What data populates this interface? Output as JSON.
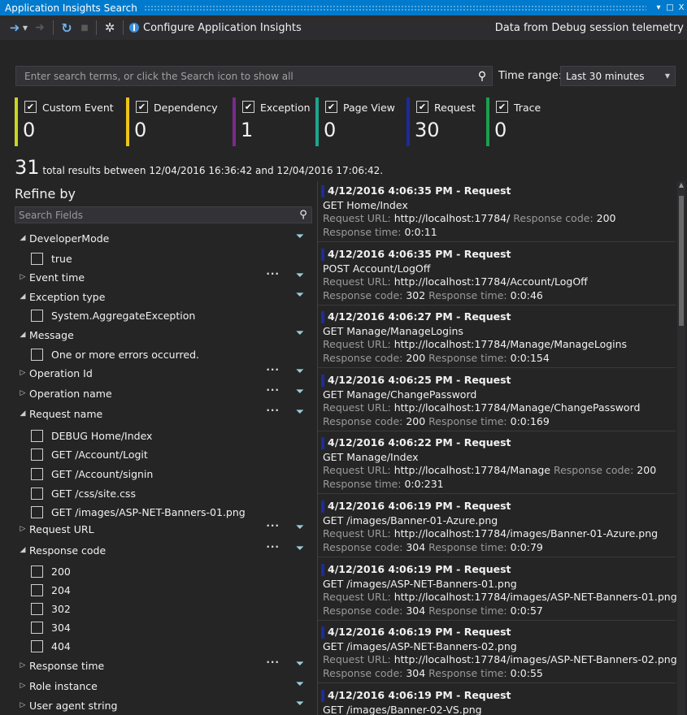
{
  "window": {
    "title": "Application Insights Search",
    "dropdown_glyph": "▾",
    "maximize_glyph": "□",
    "close_glyph": "X"
  },
  "toolbar": {
    "configure_label": "Configure Application Insights",
    "data_source": "Data from Debug session telemetry"
  },
  "search": {
    "placeholder": "Enter search terms, or click the Search icon to show all",
    "time_range_label": "Time range:",
    "time_range_value": "Last 30 minutes"
  },
  "filters": [
    {
      "label": "Custom Event",
      "count": "0",
      "color": "#c9d61d"
    },
    {
      "label": "Dependency",
      "count": "0",
      "color": "#ecc31a"
    },
    {
      "label": "Exception",
      "count": "1",
      "color": "#7b2a8c"
    },
    {
      "label": "Page View",
      "count": "0",
      "color": "#1ca68e"
    },
    {
      "label": "Request",
      "count": "30",
      "color": "#1c2b9c"
    },
    {
      "label": "Trace",
      "count": "0",
      "color": "#1aa14a"
    }
  ],
  "summary": {
    "total": "31",
    "text": "total results between 12/04/2016 16:36:42 and 12/04/2016 17:06:42."
  },
  "refine": {
    "title": "Refine by",
    "search_placeholder": "Search Fields",
    "rows": [
      {
        "label": "DeveloperMode",
        "expanded": true,
        "more": false
      },
      {
        "value": "true"
      },
      {
        "label": "Event time",
        "expanded": false,
        "more": true
      },
      {
        "label": "Exception type",
        "expanded": true,
        "more": false
      },
      {
        "value": "System.AggregateException"
      },
      {
        "label": "Message",
        "expanded": true,
        "more": false
      },
      {
        "value": "One or more errors occurred."
      },
      {
        "label": "Operation Id",
        "expanded": false,
        "more": true
      },
      {
        "label": "Operation name",
        "expanded": false,
        "more": true
      },
      {
        "label": "Request name",
        "expanded": true,
        "more": true
      },
      {
        "value": "DEBUG Home/Index"
      },
      {
        "value": "GET /Account/Logit"
      },
      {
        "value": "GET /Account/signin"
      },
      {
        "value": "GET /css/site.css"
      },
      {
        "value": "GET /images/ASP-NET-Banners-01.png"
      },
      {
        "label": "Request URL",
        "expanded": false,
        "more": true
      },
      {
        "label": "Response code",
        "expanded": true,
        "more": true
      },
      {
        "value": "200"
      },
      {
        "value": "204"
      },
      {
        "value": "302"
      },
      {
        "value": "304"
      },
      {
        "value": "404"
      },
      {
        "label": "Response time",
        "expanded": false,
        "more": true
      },
      {
        "label": "Role instance",
        "expanded": false,
        "more": false
      },
      {
        "label": "User agent string",
        "expanded": false,
        "more": false
      }
    ]
  },
  "results": [
    {
      "header": "4/12/2016 4:06:35 PM - Request",
      "name": "GET Home/Index",
      "lines": [
        [
          [
            "Request URL: ",
            "dim"
          ],
          [
            "http://localhost:17784/",
            "bright"
          ],
          [
            " Response code: ",
            "dim"
          ],
          [
            "200",
            "bright"
          ]
        ],
        [
          [
            "Response time: ",
            "dim"
          ],
          [
            "0:0:11",
            "bright"
          ]
        ]
      ]
    },
    {
      "header": "4/12/2016 4:06:35 PM - Request",
      "name": "POST Account/LogOff",
      "lines": [
        [
          [
            "Request URL: ",
            "dim"
          ],
          [
            "http://localhost:17784/Account/LogOff",
            "bright"
          ]
        ],
        [
          [
            "Response code: ",
            "dim"
          ],
          [
            "302",
            "bright"
          ],
          [
            " Response time: ",
            "dim"
          ],
          [
            "0:0:46",
            "bright"
          ]
        ]
      ]
    },
    {
      "header": "4/12/2016 4:06:27 PM - Request",
      "name": "GET Manage/ManageLogins",
      "lines": [
        [
          [
            "Request URL: ",
            "dim"
          ],
          [
            "http://localhost:17784/Manage/ManageLogins",
            "bright"
          ]
        ],
        [
          [
            "Response code: ",
            "dim"
          ],
          [
            "200",
            "bright"
          ],
          [
            " Response time: ",
            "dim"
          ],
          [
            "0:0:154",
            "bright"
          ]
        ]
      ]
    },
    {
      "header": "4/12/2016 4:06:25 PM - Request",
      "name": "GET Manage/ChangePassword",
      "lines": [
        [
          [
            "Request URL: ",
            "dim"
          ],
          [
            "http://localhost:17784/Manage/ChangePassword",
            "bright"
          ]
        ],
        [
          [
            "Response code: ",
            "dim"
          ],
          [
            "200",
            "bright"
          ],
          [
            " Response time: ",
            "dim"
          ],
          [
            "0:0:169",
            "bright"
          ]
        ]
      ]
    },
    {
      "header": "4/12/2016 4:06:22 PM - Request",
      "name": "GET Manage/Index",
      "lines": [
        [
          [
            "Request URL: ",
            "dim"
          ],
          [
            "http://localhost:17784/Manage",
            "bright"
          ],
          [
            " Response code: ",
            "dim"
          ],
          [
            "200",
            "bright"
          ]
        ],
        [
          [
            "Response time: ",
            "dim"
          ],
          [
            "0:0:231",
            "bright"
          ]
        ]
      ]
    },
    {
      "header": "4/12/2016 4:06:19 PM - Request",
      "name": "GET /images/Banner-01-Azure.png",
      "lines": [
        [
          [
            "Request URL: ",
            "dim"
          ],
          [
            "http://localhost:17784/images/Banner-01-Azure.png",
            "bright"
          ]
        ],
        [
          [
            "Response code: ",
            "dim"
          ],
          [
            "304",
            "bright"
          ],
          [
            " Response time: ",
            "dim"
          ],
          [
            "0:0:79",
            "bright"
          ]
        ]
      ]
    },
    {
      "header": "4/12/2016 4:06:19 PM - Request",
      "name": "GET /images/ASP-NET-Banners-01.png",
      "lines": [
        [
          [
            "Request URL: ",
            "dim"
          ],
          [
            "http://localhost:17784/images/ASP-NET-Banners-01.png",
            "bright"
          ]
        ],
        [
          [
            "Response code: ",
            "dim"
          ],
          [
            "304",
            "bright"
          ],
          [
            " Response time: ",
            "dim"
          ],
          [
            "0:0:57",
            "bright"
          ]
        ]
      ]
    },
    {
      "header": "4/12/2016 4:06:19 PM - Request",
      "name": "GET /images/ASP-NET-Banners-02.png",
      "lines": [
        [
          [
            "Request URL: ",
            "dim"
          ],
          [
            "http://localhost:17784/images/ASP-NET-Banners-02.png",
            "bright"
          ]
        ],
        [
          [
            "Response code: ",
            "dim"
          ],
          [
            "304",
            "bright"
          ],
          [
            " Response time: ",
            "dim"
          ],
          [
            "0:0:55",
            "bright"
          ]
        ]
      ]
    },
    {
      "header": "4/12/2016 4:06:19 PM - Request",
      "name": "GET /images/Banner-02-VS.png",
      "lines": []
    }
  ],
  "icons": {
    "back": "back-arrow-icon",
    "forward": "forward-arrow-icon",
    "refresh": "refresh-icon",
    "stop": "stop-icon",
    "settings": "gear-icon",
    "search": "search-icon",
    "filter": "funnel-icon"
  }
}
